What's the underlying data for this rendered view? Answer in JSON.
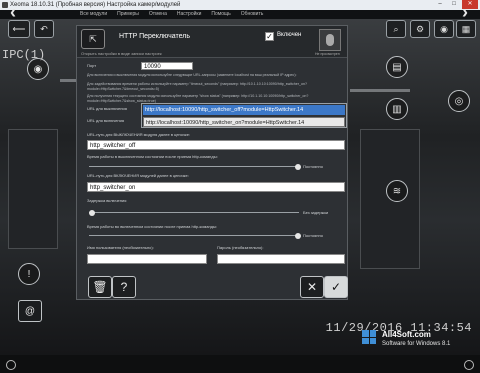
{
  "window": {
    "title": "Xeoma 18.10.31 (Пробная версия) Настройка камер/модулей",
    "buttons": [
      "–",
      "□",
      "✕"
    ]
  },
  "menubar": [
    "Все модули",
    "Примеры",
    "Отмена",
    "Настройки",
    "Помощь",
    "Обновить"
  ],
  "scene": {
    "camera_label": "IPC(1)",
    "timestamp": "11/29/2016 11:34:54"
  },
  "dialog": {
    "title": "HTTP Переключатель",
    "subtitle": "Открыть настройки в виде записи настроек",
    "enabled_checked": true,
    "enabled_label": "Включен",
    "thumbnail_label": "Не просмотрен",
    "port": {
      "label": "Порт",
      "value": "10090"
    },
    "note1": "Для включения и выключения модуля используйте следующие URL-запросы (замените localhost на ваш реальный IP адрес):",
    "note2": "Для задействования времени работы используйте параметр \"timeout_seconds\" (например: http://10.1.10.10:10090/http_switcher_on?module=HttpSwitcher.7&timeout_seconds=5)",
    "note3": "Для получения текущего состояния модуля используйте параметр \"show status\" (например: http://10.1.10.10:10090/http_switcher_on?module=HttpSwitcher.7&show_status=true)",
    "url_off_label": "URL для выключения",
    "url_on_label": "URL для включения",
    "dropdown": {
      "selected": "http://localhost:10090/http_switcher_off?module=HttpSwitcher.14",
      "option": "http://localhost:10090/http_switcher_on?module=HttpSwitcher.14"
    },
    "url_part_off_label": "URL-путь для ВЫКЛЮЧЕНИЯ модуля далее в цепочке:",
    "url_part_off_value": "http_switcher_off",
    "time_off_label": "Время работы в выключенном состоянии после приема http-команды:",
    "time_off_right": "Постоянно",
    "url_part_on_label": "URL-путь для ВКЛЮЧЕНИЯ модулей далее в цепочке:",
    "url_part_on_value": "http_switcher_on",
    "delay_label": "Задержка включения",
    "delay_right": "Без задержки",
    "time_on_label": "Время работы во включенном состоянии после приема http-команды:",
    "time_on_right": "Постоянно",
    "username_label": "Имя пользователя (необязательно):",
    "username_value": "",
    "password_label": "Пароль (необязательно):",
    "password_value": ""
  },
  "watermark": {
    "brand": "All4Soft.com",
    "sub": "Software for Windows 8.1"
  },
  "colors": {
    "accent_selection": "#3c78c8",
    "dialog_bg": "#2d3034",
    "windows_logo": "#3f8fd7"
  },
  "icons": {
    "back": "chevron-left-icon",
    "undo": "undo-icon",
    "thumb": "camera-thumbnail-icon",
    "delete": "trash-icon",
    "help": "question-icon",
    "cancel": "close-icon",
    "confirm": "check-icon",
    "expand": "chevron-down-icon"
  }
}
